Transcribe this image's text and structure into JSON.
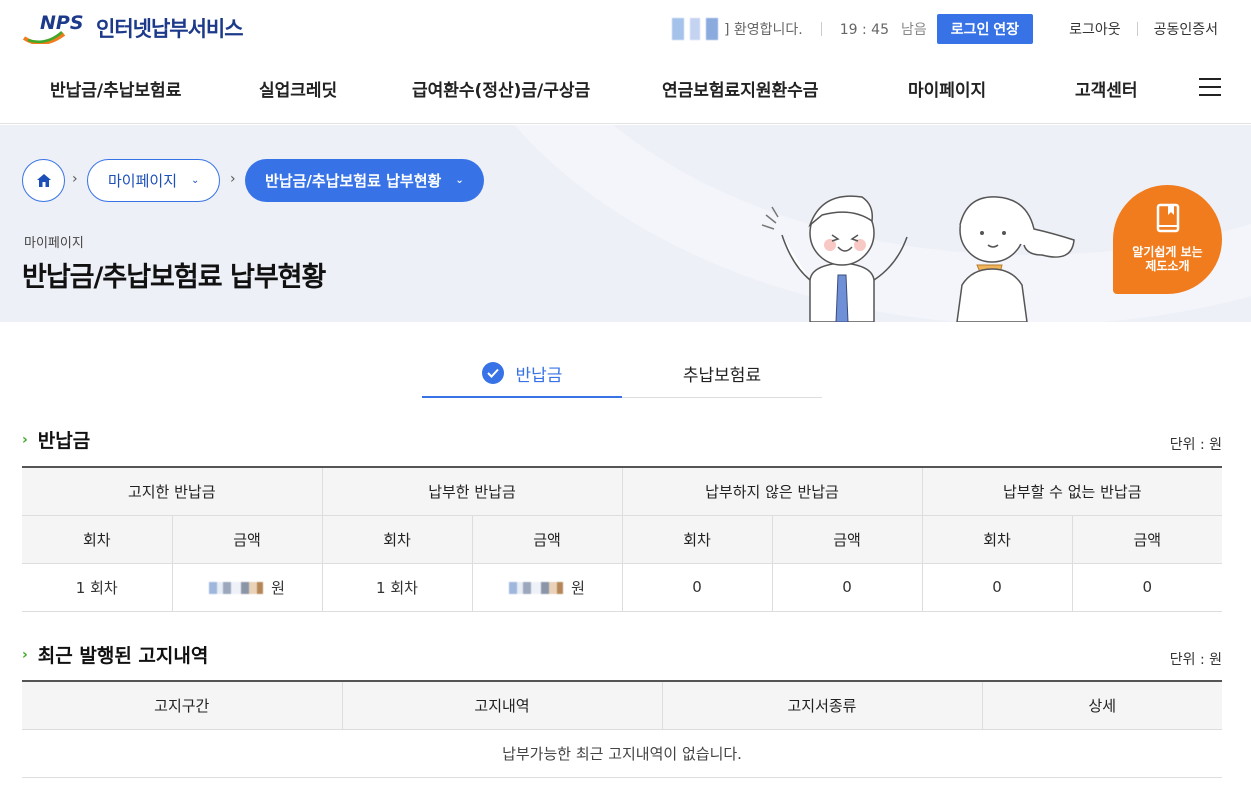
{
  "header": {
    "logo_mark": "NPS",
    "logo_text": "인터넷납부서비스",
    "welcome": "] 환영합니다.",
    "timer": "19 : 45",
    "timer_suffix": "남음",
    "extend_button": "로그인 연장",
    "logout": "로그아웃",
    "certificate": "공동인증서"
  },
  "gnb": {
    "items": [
      "반납금/추납보험료",
      "실업크레딧",
      "급여환수(정산)금/구상금",
      "연금보험료지원환수금",
      "마이페이지",
      "고객센터"
    ]
  },
  "breadcrumb": {
    "level1": "마이페이지",
    "level2": "반납금/추납보험료 납부현황"
  },
  "page": {
    "subtitle": "마이페이지",
    "title": "반납금/추납보험료 납부현황",
    "guide_line1": "알기쉽게 보는",
    "guide_line2": "제도소개"
  },
  "tabs": {
    "active": "반납금",
    "inactive": "추납보험료"
  },
  "section1": {
    "title": "반납금",
    "unit": "단위 : 원",
    "groups": [
      "고지한 반납금",
      "납부한 반납금",
      "납부하지 않은 반납금",
      "납부할 수 없는 반납금"
    ],
    "sub_round": "회차",
    "sub_amount": "금액",
    "row": {
      "notified_round": "1 회차",
      "notified_amount_suffix": "원",
      "paid_round": "1 회차",
      "paid_amount_suffix": "원",
      "unpaid_round": "0",
      "unpaid_amount": "0",
      "unpayable_round": "0",
      "unpayable_amount": "0"
    }
  },
  "section2": {
    "title": "최근 발행된 고지내역",
    "unit": "단위 : 원",
    "columns": [
      "고지구간",
      "고지내역",
      "고지서종류",
      "상세"
    ],
    "empty_message": "납부가능한 최근 고지내역이 없습니다."
  },
  "colors": {
    "primary": "#3773e6",
    "accent_orange": "#f07c1d",
    "section_mark": "#3fa82a"
  }
}
